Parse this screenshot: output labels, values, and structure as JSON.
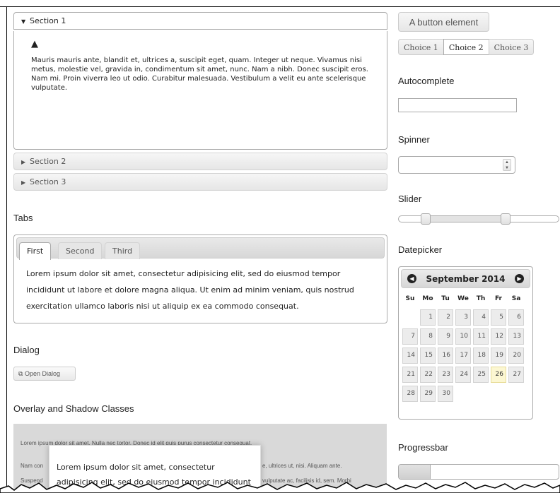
{
  "accordion": {
    "sections": [
      {
        "label": "Section 1"
      },
      {
        "label": "Section 2"
      },
      {
        "label": "Section 3"
      }
    ],
    "active_content": "Mauris mauris ante, blandit et, ultrices a, suscipit eget, quam. Integer ut neque. Vivamus nisi metus, molestie vel, gravida in, condimentum sit amet, nunc. Nam a nibh. Donec suscipit eros. Nam mi. Proin viverra leo ut odio. Curabitur malesuada. Vestibulum a velit eu ante scelerisque vulputate."
  },
  "tabs": {
    "heading": "Tabs",
    "items": [
      {
        "label": "First"
      },
      {
        "label": "Second"
      },
      {
        "label": "Third"
      }
    ],
    "content": "Lorem ipsum dolor sit amet, consectetur adipisicing elit, sed do eiusmod tempor incididunt ut labore et dolore magna aliqua. Ut enim ad minim veniam, quis nostrud exercitation ullamco laboris nisi ut aliquip ex ea commodo consequat."
  },
  "dialog": {
    "heading": "Dialog",
    "button_label": "Open Dialog"
  },
  "overlay": {
    "heading": "Overlay and Shadow Classes",
    "line1": "Lorem ipsum dolor sit amet. Nulla nec tortor. Donec id elit quis purus consectetur consequat.",
    "line2_left": "Nam con",
    "line2_right": "e, ultrices ut, nisi. Aliquam ante.",
    "line3_left": "Suspend",
    "line3_right": "vulputate ac, facilisis id, sem. Morbi",
    "popup_text": "Lorem ipsum dolor sit amet, consectetur adipisicing elit, sed do eiusmod tempor incididunt"
  },
  "button_element": {
    "label": "A button element"
  },
  "radio": {
    "choices": [
      {
        "label": "Choice 1"
      },
      {
        "label": "Choice 2"
      },
      {
        "label": "Choice 3"
      }
    ],
    "selected": "Choice 2"
  },
  "autocomplete": {
    "heading": "Autocomplete",
    "value": ""
  },
  "spinner": {
    "heading": "Spinner",
    "value": ""
  },
  "slider": {
    "heading": "Slider",
    "range": [
      0.17,
      0.67
    ]
  },
  "datepicker": {
    "heading": "Datepicker",
    "month_label": "September 2014",
    "weekdays": [
      "Su",
      "Mo",
      "Tu",
      "We",
      "Th",
      "Fr",
      "Sa"
    ],
    "leading_blanks": 1,
    "days": [
      "1",
      "2",
      "3",
      "4",
      "5",
      "6",
      "7",
      "8",
      "9",
      "10",
      "11",
      "12",
      "13",
      "14",
      "15",
      "16",
      "17",
      "18",
      "19",
      "20",
      "21",
      "22",
      "23",
      "24",
      "25",
      "26",
      "27",
      "28",
      "29",
      "30"
    ],
    "today": "26"
  },
  "progressbar": {
    "heading": "Progressbar",
    "value": 0.2
  },
  "icons": {
    "accordion_open": "triangle-down-icon",
    "accordion_closed": "triangle-right-icon",
    "warning": "alert-icon",
    "dialog": "new-window-icon",
    "prev": "circle-arrow-left-icon",
    "next": "circle-arrow-right-icon",
    "spin_up": "triangle-up-icon",
    "spin_down": "triangle-down-icon"
  }
}
